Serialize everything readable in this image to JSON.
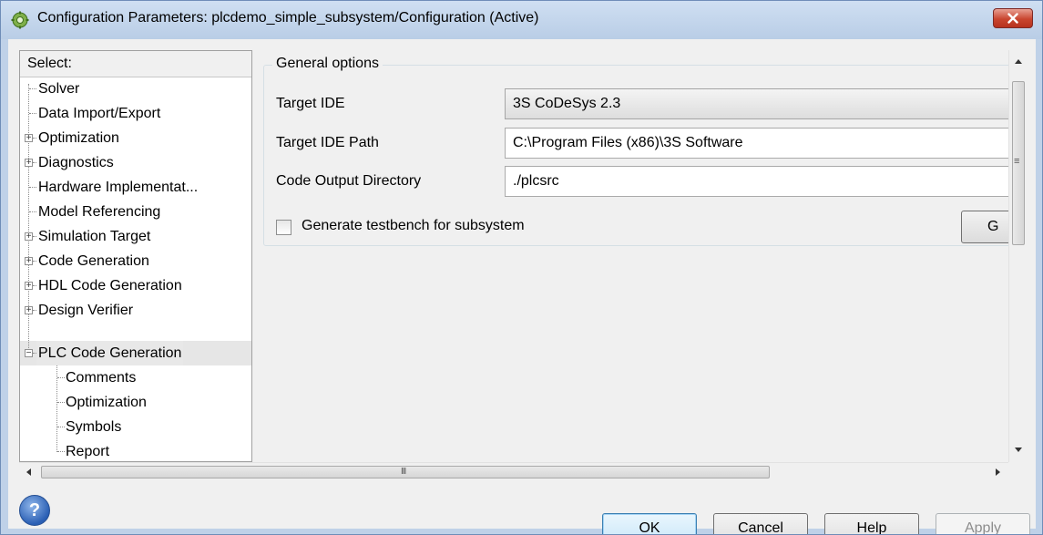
{
  "window": {
    "title": "Configuration Parameters: plcdemo_simple_subsystem/Configuration (Active)"
  },
  "tree": {
    "header": "Select:",
    "items": [
      {
        "label": "Solver"
      },
      {
        "label": "Data Import/Export"
      },
      {
        "label": "Optimization"
      },
      {
        "label": "Diagnostics"
      },
      {
        "label": "Hardware Implementat..."
      },
      {
        "label": "Model Referencing"
      },
      {
        "label": "Simulation Target"
      },
      {
        "label": "Code Generation"
      },
      {
        "label": "HDL Code Generation"
      },
      {
        "label": "Design Verifier"
      },
      {
        "label": "PLC Code Generation"
      },
      {
        "label": "Comments"
      },
      {
        "label": "Optimization"
      },
      {
        "label": "Symbols"
      },
      {
        "label": "Report"
      }
    ],
    "selected": "PLC Code Generation"
  },
  "general": {
    "legend": "General options",
    "target_ide_label": "Target IDE",
    "target_ide_value": "3S CoDeSys 2.3",
    "target_ide_path_label": "Target IDE Path",
    "target_ide_path_value": "C:\\Program Files (x86)\\3S Software",
    "code_output_dir_label": "Code Output Directory",
    "code_output_dir_value": "./plcsrc",
    "testbench_label": "Generate testbench for subsystem",
    "testbench_checked": false,
    "generate_button_label": "G"
  },
  "scrollbars": {
    "hscroll_grip_label": "III",
    "vscroll_grip_label": "≡"
  },
  "buttons": {
    "ok": "OK",
    "cancel": "Cancel",
    "help": "Help",
    "apply": "Apply"
  },
  "help_icon_glyph": "?",
  "colors": {
    "title_bar": "#bfd1e8",
    "close_button": "#c9452f",
    "ok_button_border": "#3c7fb1"
  }
}
